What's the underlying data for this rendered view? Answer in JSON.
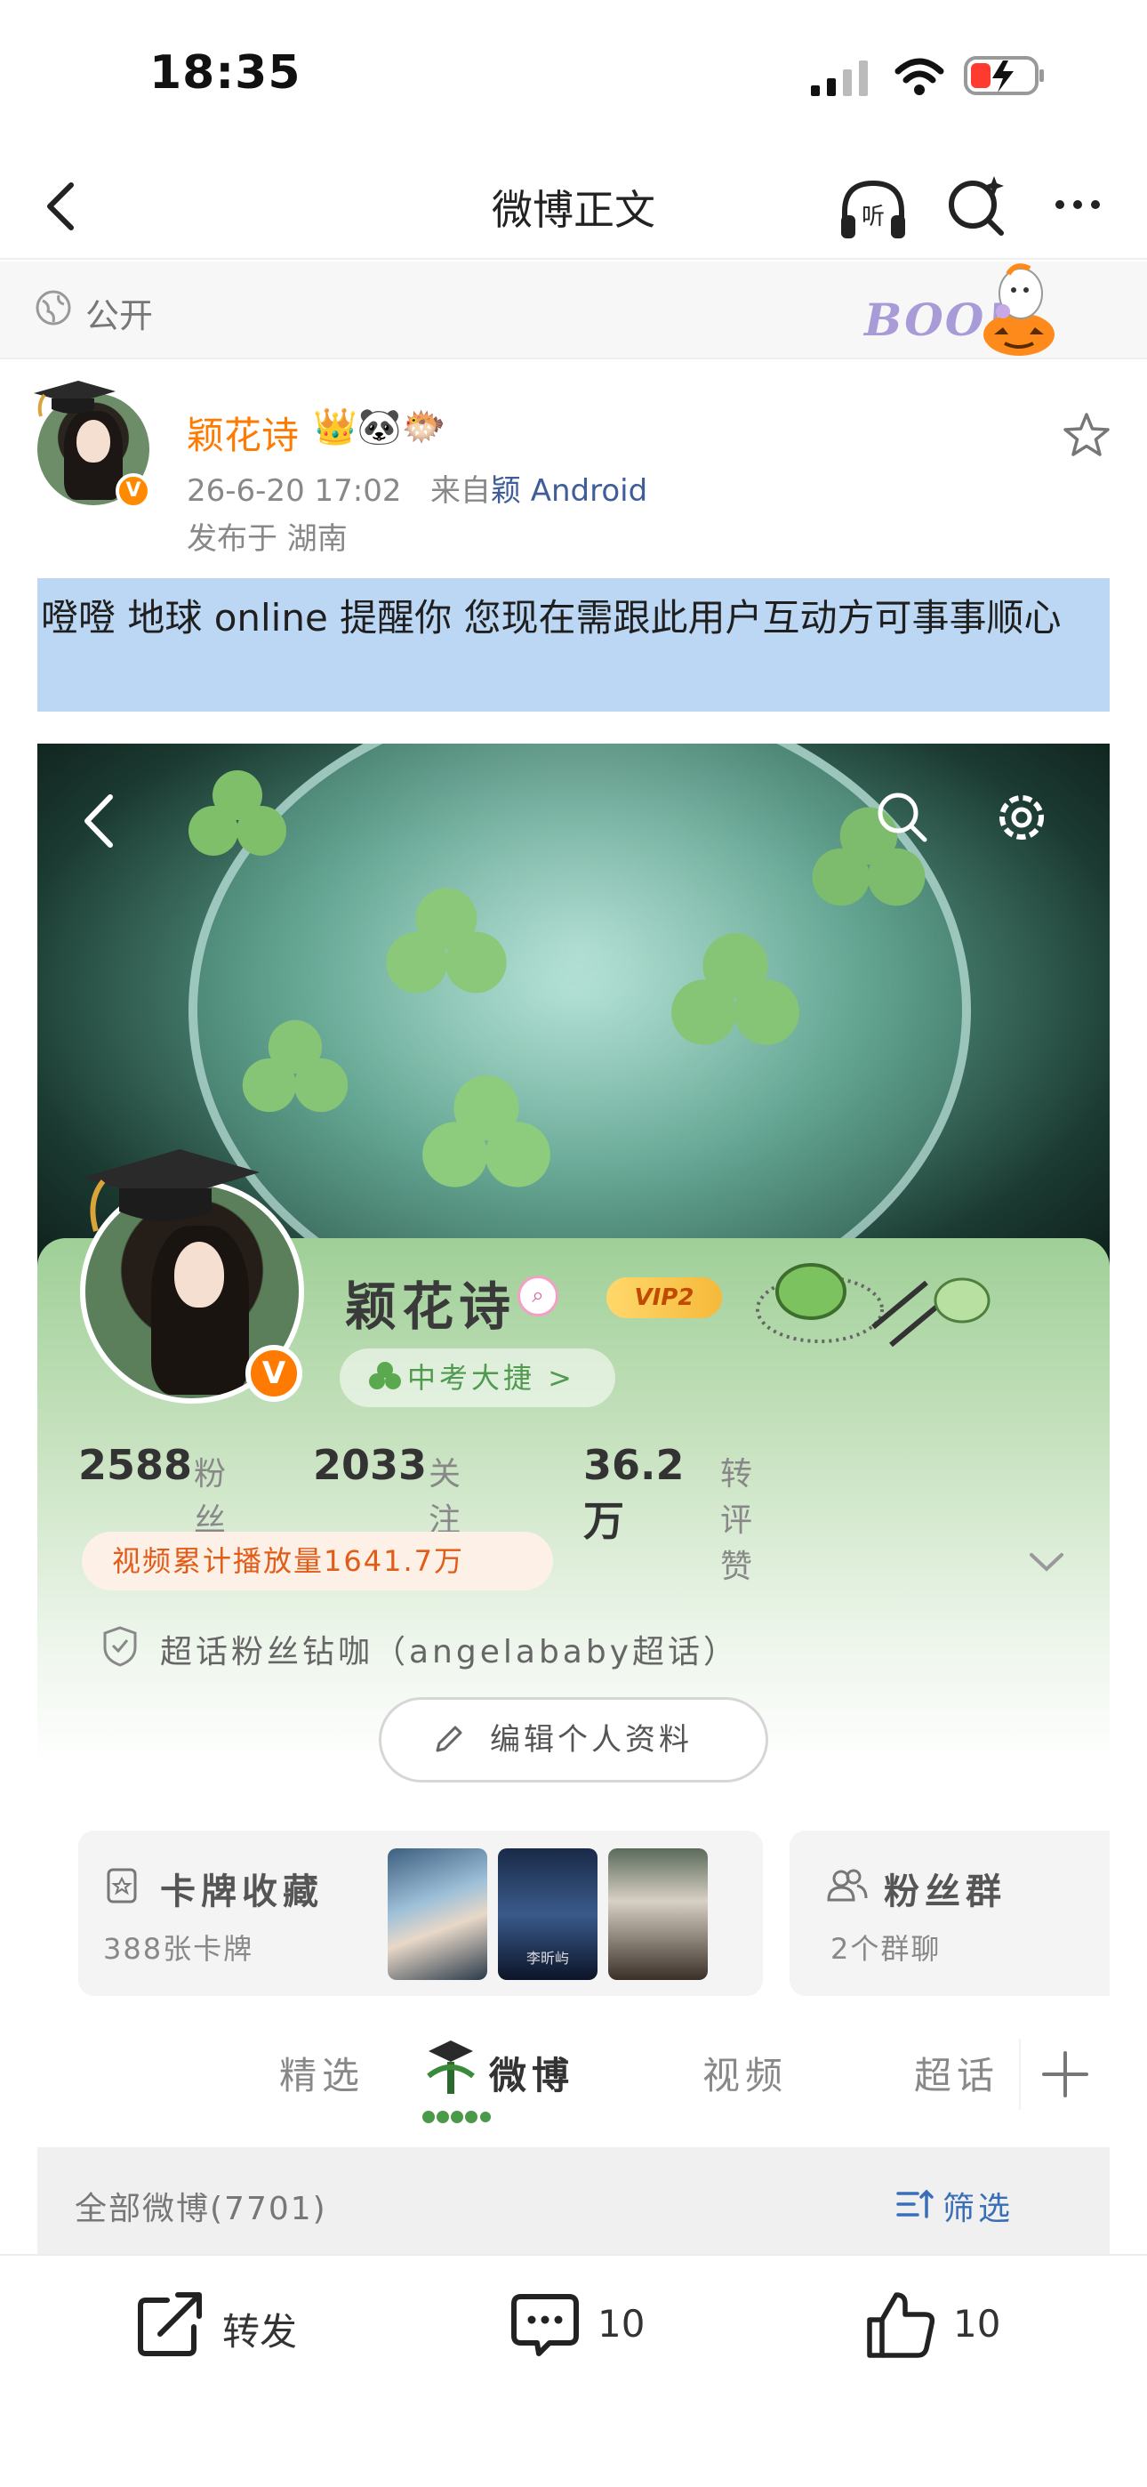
{
  "status_bar": {
    "time": "18:35"
  },
  "nav": {
    "title": "微博正文",
    "listen_label": "听"
  },
  "visibility": {
    "label": "公开",
    "boo_text": "BOO!"
  },
  "post": {
    "author": "颖花诗",
    "author_emojis": "👑🐼🐡",
    "time": "26-6-20 17:02",
    "source_prefix": "来自",
    "source": "颖 Android",
    "location": "发布于 湖南",
    "text": "噔噔 地球 online 提醒你 您现在需跟此用户互动方可事事顺心"
  },
  "profile": {
    "name": "颖花诗",
    "vip": "VIP2",
    "honor": "中考大捷 >",
    "stats": [
      {
        "value": "2588",
        "label": "粉丝"
      },
      {
        "value": "2033",
        "label": "关注"
      },
      {
        "value": "36.2万",
        "label": "转评赞"
      }
    ],
    "video_count": "视频累计播放量1641.7万",
    "super_topic": "超话粉丝钻咖（angelababy超话）",
    "edit_button": "编辑个人资料",
    "cards_title": "卡牌收藏",
    "cards_sub": "388张卡牌",
    "fans_title": "粉丝群",
    "fans_sub": "2个群聊",
    "thumb_caption": "李昕屿",
    "tabs": [
      "精选",
      "微博",
      "视频",
      "超话"
    ],
    "all_posts": "全部微博(7701)",
    "filter": "筛选"
  },
  "actions": {
    "repost": "转发",
    "comment_count": "10",
    "like_count": "10"
  },
  "colors": {
    "accent": "#ff7a00",
    "link": "#3f5d99",
    "highlight": "#bcd7f3"
  }
}
